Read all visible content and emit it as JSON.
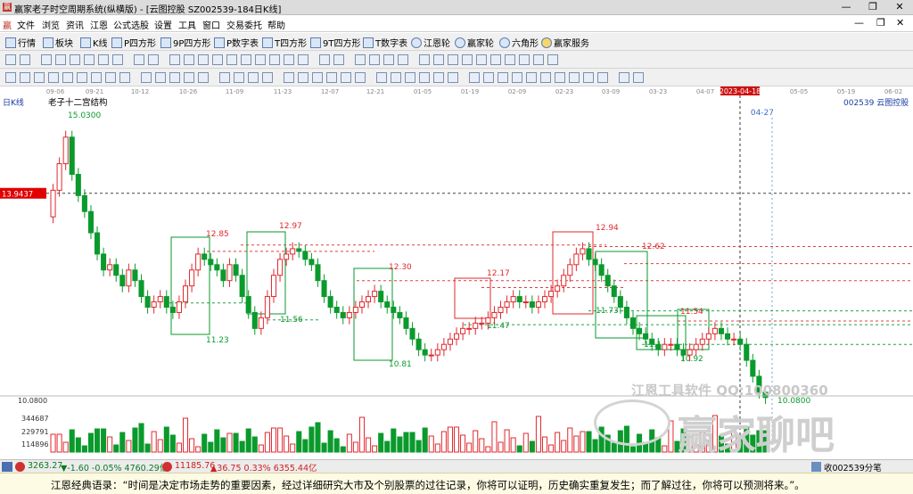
{
  "window": {
    "title": "赢家老子时空周期系统(纵横版) - [云图控股  SZ002539-184日K线]"
  },
  "menu": {
    "items": [
      "文件",
      "浏览",
      "资讯",
      "江恩",
      "公式选股",
      "设置",
      "工具",
      "窗口",
      "交易委托",
      "帮助"
    ]
  },
  "toolbar1": {
    "items": [
      "行情",
      "板块",
      "K线",
      "P四方形",
      "9P四方形",
      "P数字表",
      "T四方形",
      "9T四方形",
      "T数字表",
      "江恩轮",
      "赢家轮",
      "六角形",
      "赢家服务"
    ]
  },
  "dates": [
    "09-06",
    "09-21",
    "10-12",
    "10-26",
    "11-09",
    "11-23",
    "12-07",
    "12-21",
    "01-05",
    "01-19",
    "02-09",
    "02-23",
    "03-09",
    "03-23",
    "04-07",
    "2023-04-18",
    "05-05",
    "05-19",
    "06-02"
  ],
  "chart_data": {
    "type": "candlestick",
    "period_label": "日K线",
    "study_label": "老子十二宫结构",
    "stock_label": "002539  云图控股",
    "ylabel_price": "13.9437",
    "future_date": "04-27",
    "price_labels": [
      "15.0300",
      "12.85",
      "12.97",
      "12.30",
      "12.17",
      "12.94",
      "12.62",
      "11.54",
      "11.73",
      "11.47",
      "11.56",
      "11.23",
      "10.81",
      "11.1",
      "10.92",
      "10.08",
      "10.0800"
    ],
    "volume_axis": [
      "10.0800",
      "344687",
      "229791",
      "114896"
    ]
  },
  "statusbar": {
    "sh_index": "3263.27",
    "sh_change": "▼-1.60 -0.05% 4760.29亿",
    "sz_index": "11185.76",
    "sz_change": "▲36.75 0.33% 6355.44亿",
    "right_text": "收002539分笔"
  },
  "quote": {
    "text": "江恩经典语录：“时间是决定市场走势的重要因素，经过详细研究大市及个别股票的过往记录，你将可以证明，历史确实重复发生；而了解过往，你将可以预测将来。”。"
  },
  "watermark": {
    "line1": "江恩工具软件 QQ:100800360",
    "brand": "赢家聊吧",
    "url": "liaoba.yz"
  },
  "colors": {
    "up": "#e0282e",
    "down": "#0a9a2c",
    "bg": "#ffffff",
    "price_tag": "#e00000"
  }
}
